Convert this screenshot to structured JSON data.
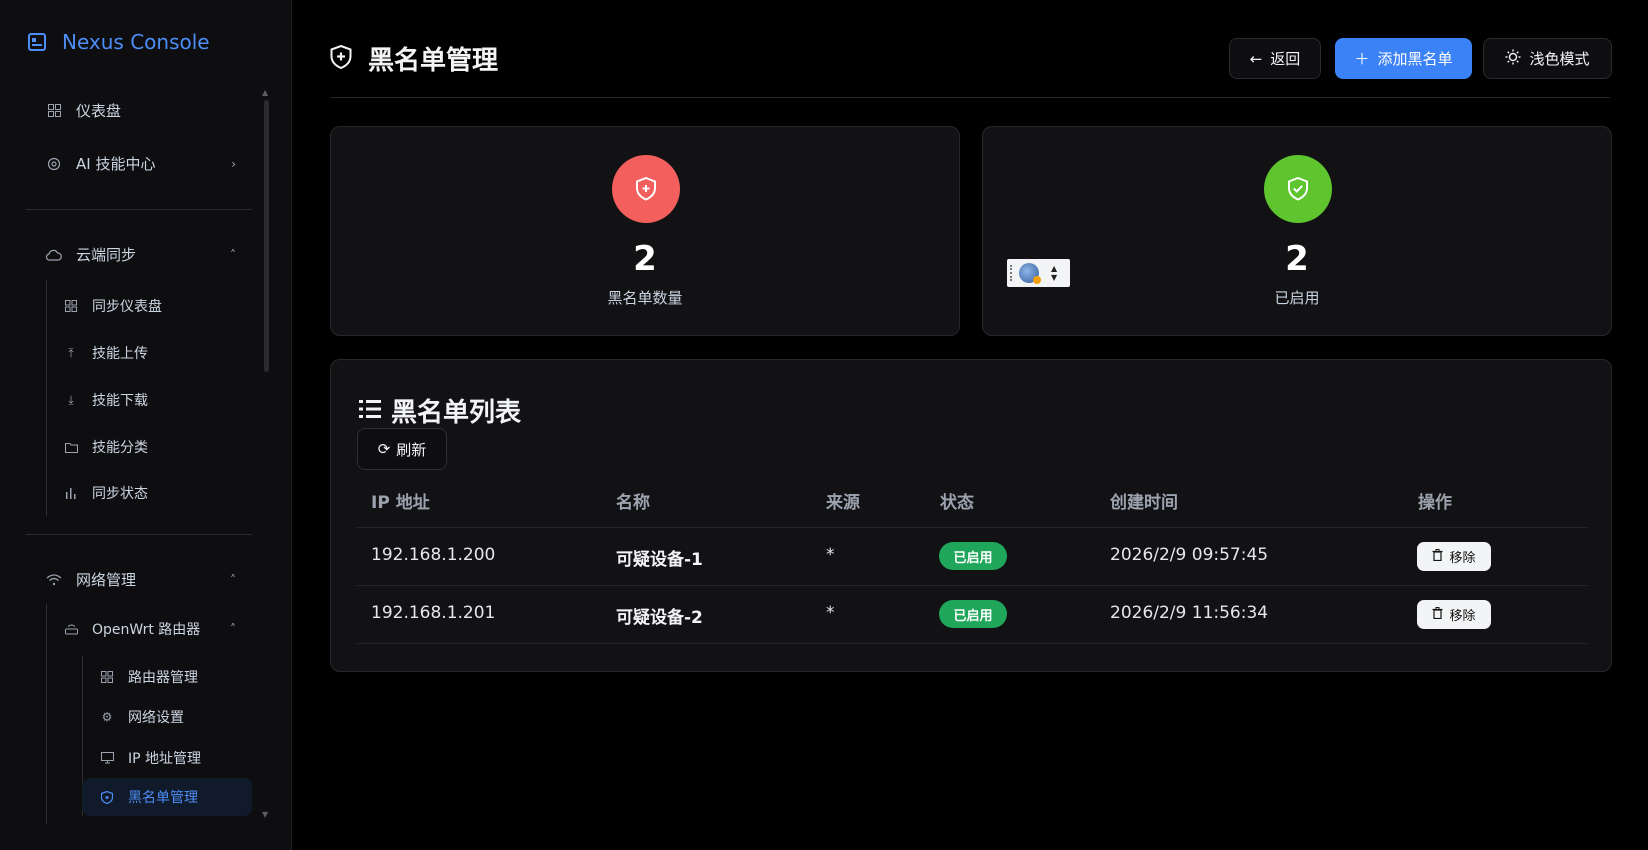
{
  "app": {
    "name": "Nexus Console"
  },
  "sidebar": {
    "items": [
      {
        "label": "仪表盘",
        "icon": "grid-icon"
      },
      {
        "label": "AI 技能中心",
        "icon": "ai-icon"
      }
    ],
    "cloud_sync": {
      "label": "云端同步",
      "children": [
        {
          "label": "同步仪表盘",
          "icon": "grid-icon"
        },
        {
          "label": "技能上传",
          "icon": "upload-icon"
        },
        {
          "label": "技能下载",
          "icon": "download-icon"
        },
        {
          "label": "技能分类",
          "icon": "folder-icon"
        },
        {
          "label": "同步状态",
          "icon": "bar-chart-icon"
        }
      ]
    },
    "network": {
      "label": "网络管理",
      "router": {
        "label": "OpenWrt 路由器",
        "children": [
          {
            "label": "路由器管理",
            "icon": "grid-icon"
          },
          {
            "label": "网络设置",
            "icon": "gear-icon"
          },
          {
            "label": "IP 地址管理",
            "icon": "monitor-icon"
          },
          {
            "label": "黑名单管理",
            "icon": "shield-icon",
            "active": true
          }
        ]
      }
    }
  },
  "header": {
    "title": "黑名单管理",
    "back_label": "返回",
    "add_label": "添加黑名单",
    "theme_label": "浅色模式"
  },
  "stats": [
    {
      "value": "2",
      "label": "黑名单数量",
      "color": "#f25f5c"
    },
    {
      "value": "2",
      "label": "已启用",
      "color": "#5ec52f"
    }
  ],
  "list": {
    "title": "黑名单列表",
    "refresh_label": "刷新",
    "columns": [
      "IP 地址",
      "名称",
      "来源",
      "状态",
      "创建时间",
      "操作"
    ],
    "rows": [
      {
        "ip": "192.168.1.200",
        "name": "可疑设备-1",
        "source": "*",
        "status": "已启用",
        "created": "2026/2/9 09:57:45",
        "action": "移除"
      },
      {
        "ip": "192.168.1.201",
        "name": "可疑设备-2",
        "source": "*",
        "status": "已启用",
        "created": "2026/2/9 11:56:34",
        "action": "移除"
      }
    ]
  },
  "colors": {
    "accent": "#3b82f6",
    "success": "#1fa65a",
    "danger": "#f25f5c"
  }
}
